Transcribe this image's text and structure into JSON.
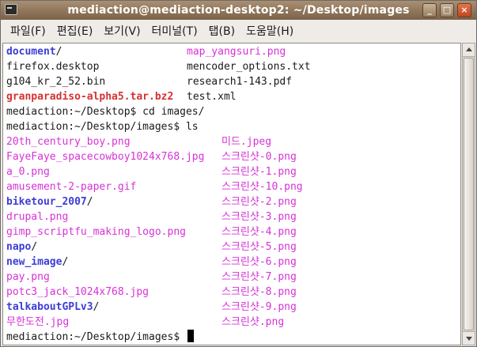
{
  "window": {
    "title": "mediaction@mediaction-desktop2: ~/Desktop/images",
    "buttons": {
      "minimize": "_",
      "maximize": "□",
      "close": "×"
    }
  },
  "menubar": [
    "파일(F)",
    "편집(E)",
    "보기(V)",
    "터미널(T)",
    "탭(B)",
    "도움말(H)"
  ],
  "terminal": {
    "rows": [
      {
        "left": "document",
        "left_type": "dir",
        "left_suffix": "/",
        "right": "map_yangsuri.png",
        "right_type": "img"
      },
      {
        "left": "firefox.desktop",
        "left_type": "plain",
        "right": "mencoder_options.txt",
        "right_type": "plain"
      },
      {
        "left": "g104_kr_2_52.bin",
        "left_type": "plain",
        "right": "research1-143.pdf",
        "right_type": "plain"
      },
      {
        "left": "granparadiso-alpha5.tar.bz2",
        "left_type": "arc",
        "right": "test.xml",
        "right_type": "plain"
      },
      {
        "left": "mediaction:~/Desktop$ cd images/",
        "left_type": "plain"
      },
      {
        "left": "mediaction:~/Desktop/images$ ls",
        "left_type": "plain"
      },
      {
        "left": "20th_century_boy.png",
        "left_type": "img",
        "right": "미드.jpeg",
        "right_type": "img"
      },
      {
        "left": "FayeFaye_spacecowboy1024x768.jpg",
        "left_type": "img",
        "right": "스크린샷-0.png",
        "right_type": "img"
      },
      {
        "left": "a_0.png",
        "left_type": "img",
        "right": "스크린샷-1.png",
        "right_type": "img"
      },
      {
        "left": "amusement-2-paper.gif",
        "left_type": "img",
        "right": "스크린샷-10.png",
        "right_type": "img"
      },
      {
        "left": "biketour_2007",
        "left_type": "dir",
        "left_suffix": "/",
        "right": "스크린샷-2.png",
        "right_type": "img"
      },
      {
        "left": "drupal.png",
        "left_type": "img",
        "right": "스크린샷-3.png",
        "right_type": "img"
      },
      {
        "left": "gimp_scriptfu_making_logo.png",
        "left_type": "img",
        "right": "스크린샷-4.png",
        "right_type": "img"
      },
      {
        "left": "napo",
        "left_type": "dir",
        "left_suffix": "/",
        "right": "스크린샷-5.png",
        "right_type": "img"
      },
      {
        "left": "new_image",
        "left_type": "dir",
        "left_suffix": "/",
        "right": "스크린샷-6.png",
        "right_type": "img"
      },
      {
        "left": "pay.png",
        "left_type": "img",
        "right": "스크린샷-7.png",
        "right_type": "img"
      },
      {
        "left": "potc3_jack_1024x768.jpg",
        "left_type": "img",
        "right": "스크린샷-8.png",
        "right_type": "img"
      },
      {
        "left": "talkaboutGPLv3",
        "left_type": "dir",
        "left_suffix": "/",
        "right": "스크린샷-9.png",
        "right_type": "img"
      },
      {
        "left": "무한도전.jpg",
        "left_type": "img",
        "right": "스크린샷.png",
        "right_type": "img"
      },
      {
        "left": "mediaction:~/Desktop/images$ ",
        "left_type": "plain",
        "cursor": true
      }
    ]
  },
  "colors": {
    "directory": "#3d3dd6",
    "image": "#d632d6",
    "archive": "#d63232",
    "titlebar_top": "#a98f72",
    "titlebar_bottom": "#7a6148"
  }
}
